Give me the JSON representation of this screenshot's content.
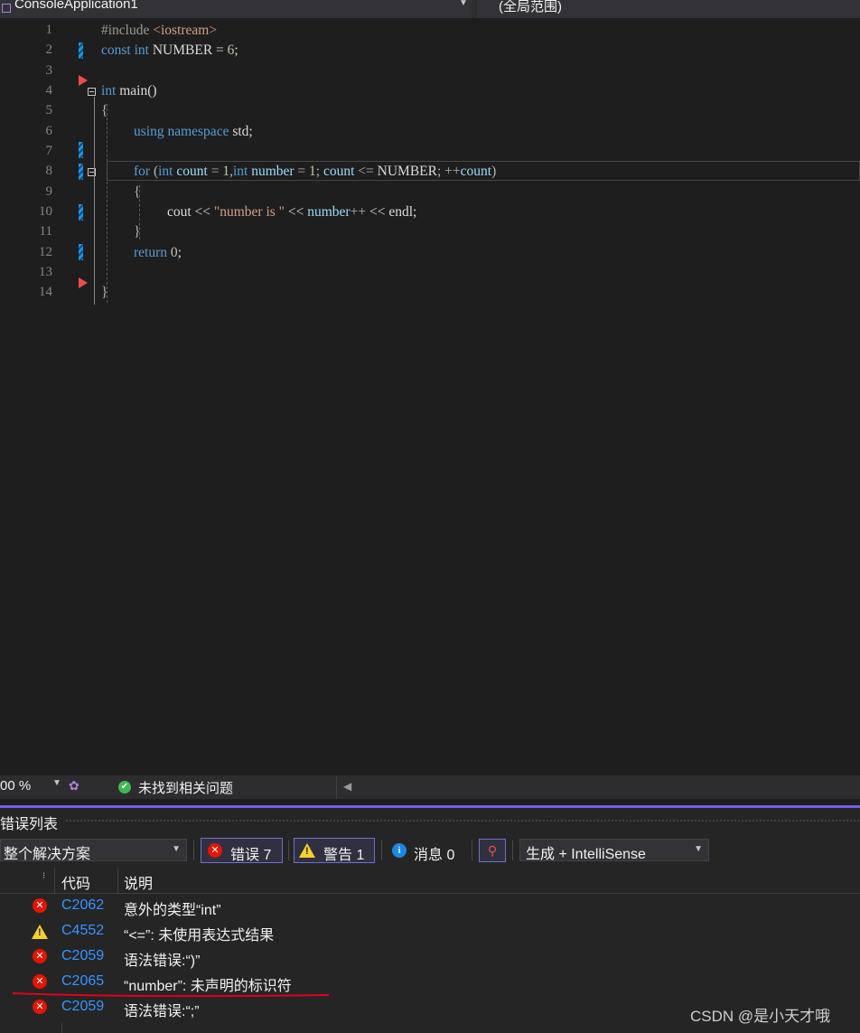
{
  "navbar": {
    "project_name": "ConsoleApplication1",
    "scope_name": "(全局范围)"
  },
  "editor": {
    "line_numbers": [
      "1",
      "2",
      "3",
      "4",
      "5",
      "6",
      "7",
      "8",
      "9",
      "10",
      "11",
      "12",
      "13",
      "14"
    ],
    "lines": {
      "l1_pp": "#include ",
      "l1_inc": "<iostream>",
      "l2_kw1": "const",
      "l2_kw2": "int",
      "l2_rest": " NUMBER = ",
      "l2_num": "6",
      "l2_end": ";",
      "l4_kw": "int",
      "l4_rest": " main()",
      "l5": "{",
      "l6_kw": "using namespace",
      "l6_rest": " std;",
      "l8_kw": "for",
      "l8_p1": " (",
      "l8_kw2": "int",
      "l8_id1": " count",
      "l8_op1": " = ",
      "l8_n1": "1",
      "l8_c1": ",",
      "l8_kw3": "int",
      "l8_id2": " number",
      "l8_op2": " = ",
      "l8_n2": "1",
      "l8_s1": "; ",
      "l8_id3": "count",
      "l8_op3": " <= ",
      "l8_id4": "NUMBER",
      "l8_s2": "; ",
      "l8_op4": "++",
      "l8_id5": "count",
      "l8_p2": ")",
      "l9": "{",
      "l10_a": "cout << ",
      "l10_str": "\"number is \"",
      "l10_b": " << ",
      "l10_id": "number",
      "l10_op": "++",
      "l10_c": " << endl;",
      "l11": "}",
      "l12_kw": "return",
      "l12_sp": " ",
      "l12_num": "0",
      "l12_end": ";",
      "l14": "}"
    }
  },
  "statusbar": {
    "zoom": "00 %",
    "issues": "未找到相关问题"
  },
  "error_list": {
    "title": "错误列表",
    "scope": "整个解决方案",
    "errors_label": "错误 7",
    "warnings_label": "警告 1",
    "messages_label": "消息 0",
    "build_filter": "生成 + IntelliSense",
    "col_code": "代码",
    "col_desc": "说明",
    "rows": [
      {
        "type": "error",
        "code": "C2062",
        "desc": "意外的类型“int”"
      },
      {
        "type": "warning",
        "code": "C4552",
        "desc": "“<=”: 未使用表达式结果"
      },
      {
        "type": "error",
        "code": "C2059",
        "desc": "语法错误:“)”"
      },
      {
        "type": "error",
        "code": "C2065",
        "desc": "“number”: 未声明的标识符"
      },
      {
        "type": "error",
        "code": "C2059",
        "desc": "语法错误:“;”"
      }
    ]
  },
  "watermark": "CSDN @是小天才哦",
  "colors": {
    "error": "#e51400",
    "warning": "#f8d02d",
    "info": "#1b88e6",
    "accent": "#7160e8",
    "underline": "#e0001b"
  }
}
